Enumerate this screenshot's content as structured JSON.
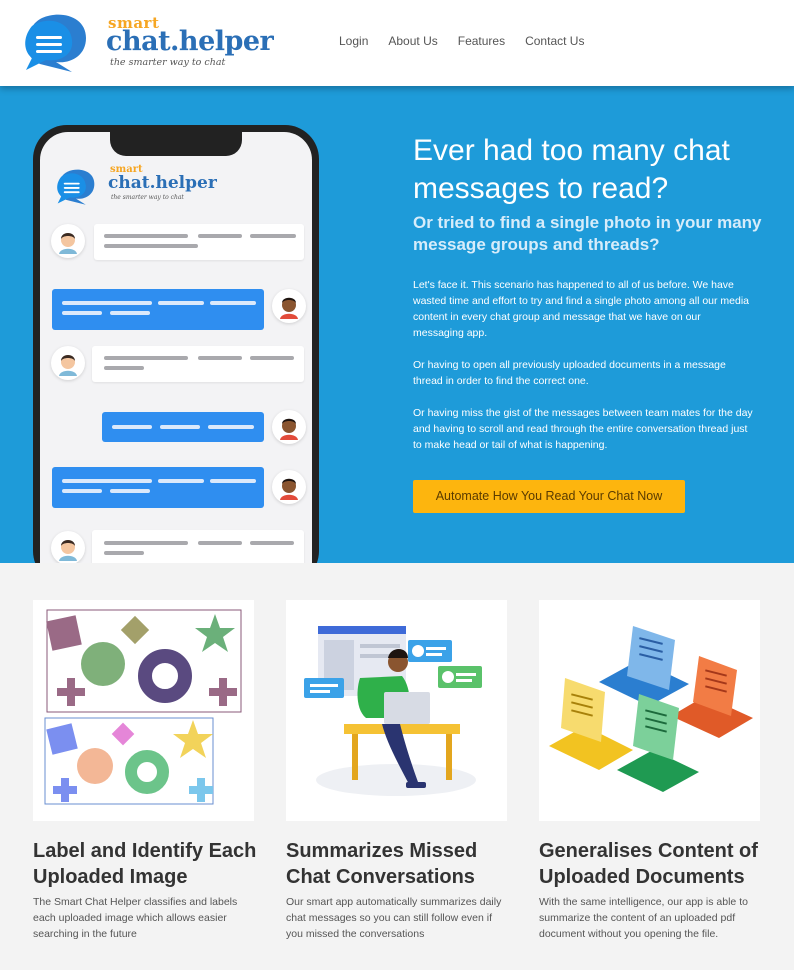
{
  "header": {
    "logo": {
      "small": "smart",
      "big": "chat.helper",
      "tagline": "the smarter way to chat"
    },
    "nav": [
      {
        "label": "Login"
      },
      {
        "label": "About Us"
      },
      {
        "label": "Features"
      },
      {
        "label": "Contact Us"
      }
    ]
  },
  "hero": {
    "phone_logo": {
      "small": "smart",
      "big": "chat.helper",
      "tagline": "the smarter way to chat"
    },
    "title": "Ever had too many chat messages to read?",
    "subtitle": "Or tried to find a single photo in your many message groups and threads?",
    "paragraphs": [
      "Let's face it. This scenario has happened to all of us before. We have wasted time and effort to try and find a single photo among all our media content in every chat group and message that we have on our messaging app.",
      "Or having to open all previously uploaded documents in a message thread in order to find the correct one.",
      "Or having miss the gist of the messages between team mates for the day and having to scroll and read through the entire conversation thread just to make head or tail of what is happening."
    ],
    "cta_label": "Automate How You Read Your Chat Now"
  },
  "features": [
    {
      "title": "Label and Identify Each Uploaded Image",
      "text": "The Smart Chat Helper classifies and labels each uploaded image which allows easier searching in the future"
    },
    {
      "title": "Summarizes Missed Chat Conversations",
      "text": "Our smart app automatically summarizes daily chat messages so you can still follow even if you missed the conversations"
    },
    {
      "title": "Generalises Content of Uploaded Documents",
      "text": "With the same intelligence, our app is able to summarize the content of an uploaded pdf document without you opening the file."
    }
  ],
  "colors": {
    "hero_bg": "#1e9bd9",
    "cta_bg": "#fdb50e",
    "brand_blue": "#2b6fb6",
    "brand_orange": "#f6a623",
    "bubble_blue": "#2f8ef0"
  }
}
